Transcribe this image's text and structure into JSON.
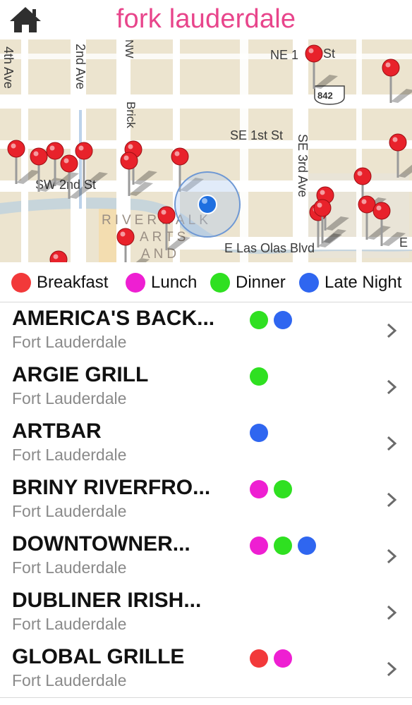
{
  "header": {
    "title": "fork lauderdale",
    "home_icon": "home-icon"
  },
  "map": {
    "labels": {
      "ne1st": "NE 1",
      "ne1st_suffix": "St",
      "se1st": "SE 1st St",
      "sw2nd": "SW 2nd St",
      "se3rd": "SE 3rd Ave",
      "ave4th": "4th Ave",
      "ave2nd": "2nd Ave",
      "brick": "Brick",
      "nw": "NW",
      "lasolas": "E Las Olas Blvd",
      "riverwalk": "RIVERWALK",
      "arts": "ARTS",
      "and": "AND",
      "shield": "842",
      "edge_e": "E"
    },
    "pin_color": "#e8222b",
    "user_location_color": "#1e6fe0"
  },
  "legend": [
    {
      "label": "Breakfast",
      "color": "#f2393a"
    },
    {
      "label": "Lunch",
      "color": "#ee1fd2"
    },
    {
      "label": "Dinner",
      "color": "#2fe021"
    },
    {
      "label": "Late Night",
      "color": "#2f66f0"
    }
  ],
  "colors": {
    "breakfast": "#f2393a",
    "lunch": "#ee1fd2",
    "dinner": "#2fe021",
    "late_night": "#2f66f0"
  },
  "restaurants": [
    {
      "name": "AMERICA'S BACK...",
      "city": "Fort Lauderdale",
      "tags": [
        "dinner",
        "late_night"
      ]
    },
    {
      "name": "ARGIE GRILL",
      "city": "Fort Lauderdale",
      "tags": [
        "dinner"
      ]
    },
    {
      "name": "ARTBAR",
      "city": "Fort Lauderdale",
      "tags": [
        "late_night"
      ]
    },
    {
      "name": "BRINY RIVERFRO...",
      "city": "Fort Lauderdale",
      "tags": [
        "lunch",
        "dinner"
      ]
    },
    {
      "name": "DOWNTOWNER...",
      "city": "Fort Lauderdale",
      "tags": [
        "lunch",
        "dinner",
        "late_night"
      ]
    },
    {
      "name": "DUBLINER IRISH...",
      "city": "Fort Lauderdale",
      "tags": []
    },
    {
      "name": "GLOBAL GRILLE",
      "city": "Fort Lauderdale",
      "tags": [
        "breakfast",
        "lunch"
      ]
    }
  ]
}
